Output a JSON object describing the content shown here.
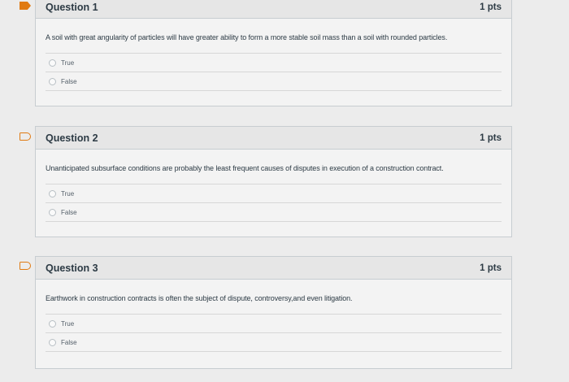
{
  "questions": [
    {
      "title": "Question 1",
      "points": "1 pts",
      "text": "A soil with great angularity of particles will have greater ability to form a more stable soil mass than a soil with rounded particles.",
      "answers": [
        "True",
        "False"
      ]
    },
    {
      "title": "Question 2",
      "points": "1 pts",
      "text": "Unanticipated subsurface conditions are probably the least frequent causes of disputes in execution of a construction contract.",
      "answers": [
        "True",
        "False"
      ]
    },
    {
      "title": "Question 3",
      "points": "1 pts",
      "text": "Earthwork in construction contracts is often the subject of dispute, controversy,and even litigation.",
      "answers": [
        "True",
        "False"
      ]
    }
  ],
  "colors": {
    "flag": "#e07a12",
    "header_bg": "#e6e6e6",
    "border": "#c7cdd1"
  },
  "icons": [
    "flag-filled-icon",
    "flag-outline-icon",
    "radio-icon"
  ]
}
